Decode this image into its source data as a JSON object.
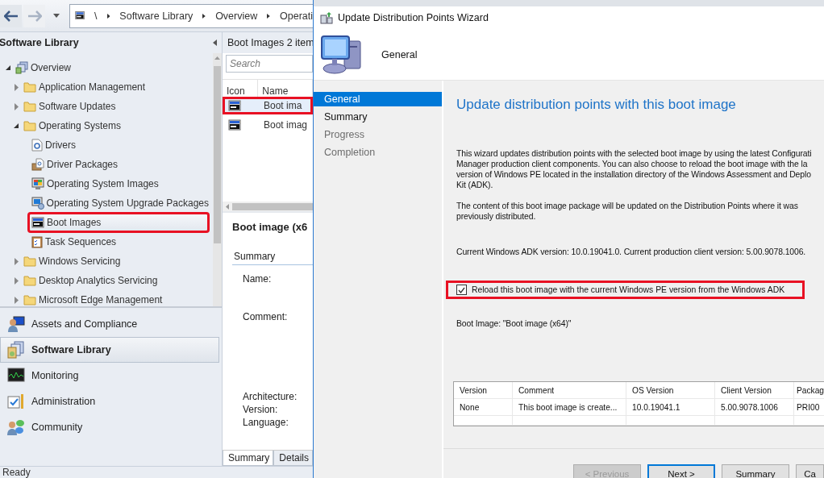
{
  "console": {
    "breadcrumb": [
      "\\",
      "Software Library",
      "Overview",
      "Operati"
    ],
    "navigation": {
      "title": "Software Library",
      "tree": [
        {
          "label": "Overview",
          "kind": "overview",
          "expanded": true,
          "selected": false,
          "highlighted": false,
          "children": [
            {
              "label": "Application Management",
              "kind": "folder",
              "expanded": false,
              "selected": false,
              "highlighted": false
            },
            {
              "label": "Software Updates",
              "kind": "folder",
              "expanded": false,
              "selected": false,
              "highlighted": false
            },
            {
              "label": "Operating Systems",
              "kind": "folder",
              "expanded": true,
              "selected": false,
              "highlighted": false,
              "children": [
                {
                  "label": "Drivers",
                  "kind": "drivers",
                  "selected": false,
                  "highlighted": false
                },
                {
                  "label": "Driver Packages",
                  "kind": "package",
                  "selected": false,
                  "highlighted": false
                },
                {
                  "label": "Operating System Images",
                  "kind": "os-image",
                  "selected": false,
                  "highlighted": false
                },
                {
                  "label": "Operating System Upgrade Packages",
                  "kind": "upgrade",
                  "selected": false,
                  "highlighted": false
                },
                {
                  "label": "Boot Images",
                  "kind": "boot-image",
                  "selected": true,
                  "highlighted": true
                },
                {
                  "label": "Task Sequences",
                  "kind": "task-sequence",
                  "selected": false,
                  "highlighted": false
                }
              ]
            },
            {
              "label": "Windows Servicing",
              "kind": "folder",
              "expanded": false,
              "selected": false,
              "highlighted": false
            },
            {
              "label": "Desktop Analytics Servicing",
              "kind": "folder",
              "expanded": false,
              "selected": false,
              "highlighted": false
            },
            {
              "label": "Microsoft Edge Management",
              "kind": "folder",
              "expanded": false,
              "selected": false,
              "highlighted": false
            }
          ]
        }
      ],
      "workspaces": [
        {
          "label": "Assets and Compliance",
          "kind": "assets",
          "selected": false
        },
        {
          "label": "Software Library",
          "kind": "library",
          "selected": true
        },
        {
          "label": "Monitoring",
          "kind": "monitoring",
          "selected": false
        },
        {
          "label": "Administration",
          "kind": "administration",
          "selected": false
        },
        {
          "label": "Community",
          "kind": "community",
          "selected": false
        }
      ]
    },
    "list_pane": {
      "title": "Boot Images 2 item",
      "search": {
        "placeholder": "Search"
      },
      "columns": [
        "Icon",
        "Name"
      ],
      "rows": [
        {
          "name": "Boot ima",
          "selected": true,
          "highlighted": true
        },
        {
          "name": "Boot imag",
          "selected": false,
          "highlighted": false
        }
      ]
    },
    "details_pane": {
      "title": "Boot image (x6",
      "section": "Summary",
      "field_groups": [
        [
          "Name:"
        ],
        [
          "Comment:"
        ],
        [
          "Architecture:",
          "Version:",
          "Language:"
        ]
      ],
      "tabs": [
        {
          "label": "Summary",
          "selected": true
        },
        {
          "label": "Details",
          "selected": false
        }
      ]
    },
    "status_bar": "Ready"
  },
  "wizard": {
    "title": "Update Distribution Points Wizard",
    "header": "General",
    "steps": [
      {
        "label": "General",
        "selected": true,
        "disabled": false
      },
      {
        "label": "Summary",
        "selected": false,
        "disabled": false
      },
      {
        "label": "Progress",
        "selected": false,
        "disabled": true
      },
      {
        "label": "Completion",
        "selected": false,
        "disabled": true
      }
    ],
    "heading": "Update distribution points with this boot image",
    "intro_lines": [
      "This wizard updates distribution points with the selected boot image by using the latest Configurati",
      "Manager production client components. You can also choose to reload the boot image with the la",
      "version of Windows PE located in the installation directory of the Windows Assessment and Deplo",
      "Kit (ADK)."
    ],
    "content_lines": [
      "The content of this boot image package will be updated on the Distribution Points where it was",
      "previously distributed."
    ],
    "adk_info": "Current Windows ADK version: 10.0.19041.0. Current production client version: 5.00.9078.1006.",
    "reload_option": {
      "label": "Reload this boot image with the current Windows PE version from the Windows ADK",
      "checked": true,
      "highlighted": true
    },
    "boot_image": "Boot Image: \"Boot image (x64)\"",
    "table": {
      "columns": [
        "Version",
        "Comment",
        "OS Version",
        "Client Version",
        "Packag"
      ],
      "rows": [
        [
          "None",
          "This boot image is create...",
          "10.0.19041.1",
          "5.00.9078.1006",
          "PRI00"
        ]
      ]
    },
    "buttons": [
      {
        "label": "< Previous",
        "disabled": true,
        "default": false
      },
      {
        "label": "Next >",
        "disabled": false,
        "default": true
      },
      {
        "label": "Summary",
        "disabled": false,
        "default": false
      },
      {
        "label": "Ca",
        "disabled": false,
        "default": false
      }
    ]
  }
}
